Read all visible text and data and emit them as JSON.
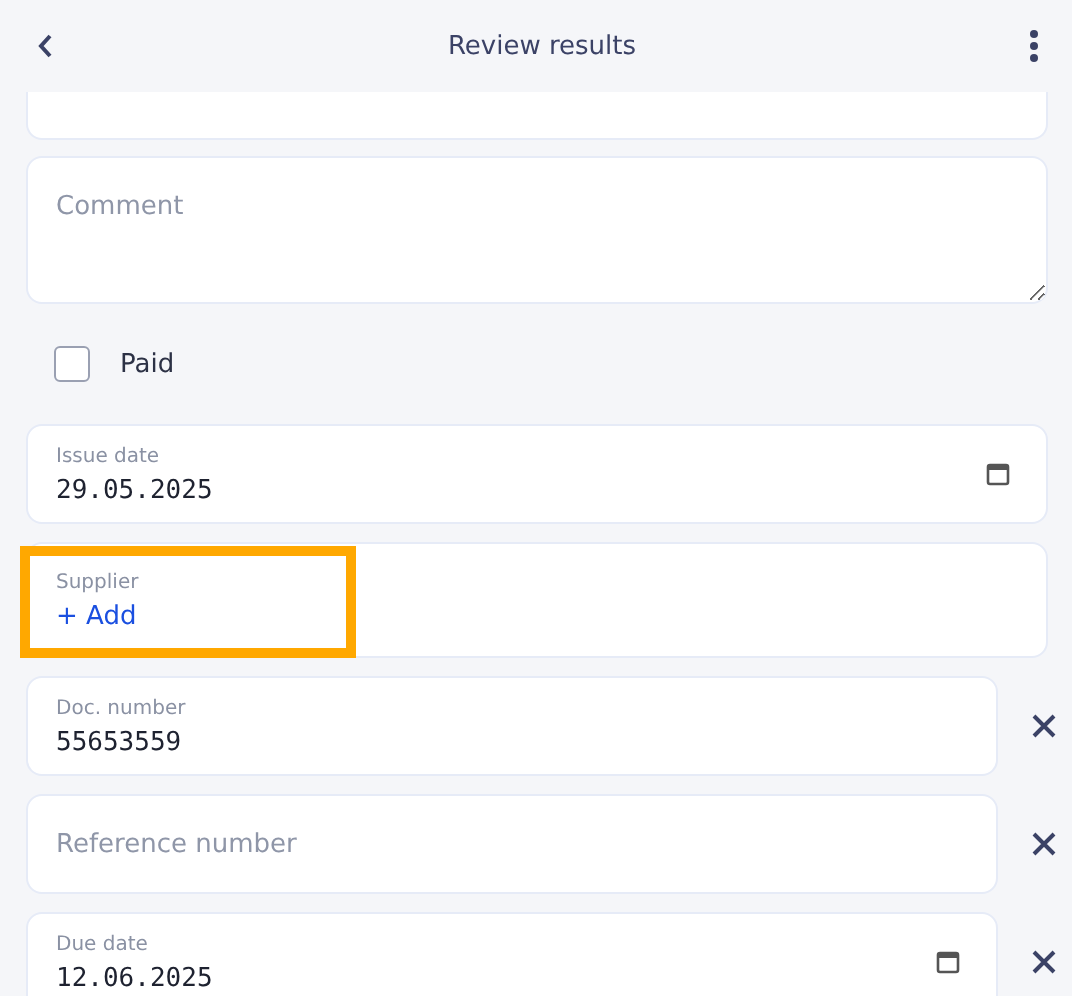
{
  "header": {
    "title": "Review results"
  },
  "fields": [
    {
      "kind": "select"
    },
    {
      "kind": "textarea",
      "placeholder": "Comment"
    },
    {
      "kind": "checkbox",
      "label": "Paid",
      "checked": false
    },
    {
      "kind": "date",
      "label": "Issue date",
      "value": "29.05.2025",
      "removable": false
    },
    {
      "kind": "supplier",
      "label": "Supplier",
      "action": "+ Add",
      "highlighted": true
    },
    {
      "kind": "text",
      "label": "Doc. number",
      "value": "55653559",
      "removable": true
    },
    {
      "kind": "text",
      "placeholder": "Reference number",
      "removable": true
    },
    {
      "kind": "date",
      "label": "Due date",
      "value": "12.06.2025",
      "removable": true
    }
  ]
}
